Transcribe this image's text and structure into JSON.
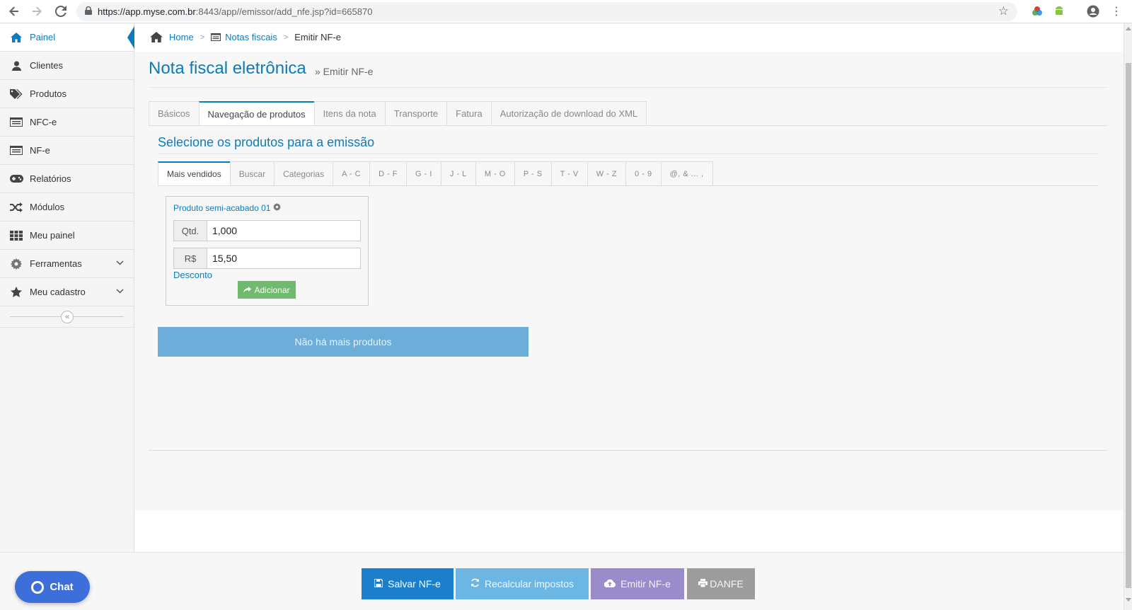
{
  "browser": {
    "url_host": "https://app.myse.com.br",
    "url_rest": ":8443/app//emissor/add_nfe.jsp?id=665870"
  },
  "sidebar": {
    "items": [
      {
        "label": "Painel",
        "icon": "home-icon"
      },
      {
        "label": "Clientes",
        "icon": "user-icon"
      },
      {
        "label": "Produtos",
        "icon": "tags-icon"
      },
      {
        "label": "NFC-e",
        "icon": "list-icon"
      },
      {
        "label": "NF-e",
        "icon": "list-icon"
      },
      {
        "label": "Relatórios",
        "icon": "gamepad-icon"
      },
      {
        "label": "Módulos",
        "icon": "shuffle-icon"
      },
      {
        "label": "Meu painel",
        "icon": "grid-icon"
      },
      {
        "label": "Ferramentas",
        "icon": "gear-icon"
      },
      {
        "label": "Meu cadastro",
        "icon": "star-icon"
      }
    ],
    "collapse_glyph": "«"
  },
  "breadcrumb": {
    "home": "Home",
    "notas": "Notas fiscais",
    "current": "Emitir NF-e"
  },
  "page": {
    "title": "Nota fiscal eletrônica",
    "subtitle": "» Emitir NF-e"
  },
  "main_tabs": [
    "Básicos",
    "Navegação de produtos",
    "Itens da nota",
    "Transporte",
    "Fatura",
    "Autorização de download do XML"
  ],
  "section_title": "Selecione os produtos para a emissão",
  "sub_tabs": [
    "Mais vendidos",
    "Buscar",
    "Categorias",
    "A - C",
    "D - F",
    "G - I",
    "J - L",
    "M - O",
    "P - S",
    "T - V",
    "W - Z",
    "0 - 9",
    "@, & ... ,"
  ],
  "product": {
    "name": "Produto semi-acabado 01",
    "qty_label": "Qtd.",
    "qty_value": "1,000",
    "price_label": "R$",
    "price_value": "15,50",
    "discount_label": "Desconto",
    "add_label": "Adicionar"
  },
  "no_more_products": "Não há mais produtos",
  "footer": {
    "chat": "Chat",
    "save": "Salvar NF-e",
    "recalc": "Recalcular impostos",
    "emit": "Emitir NF-e",
    "danfe": "DANFE"
  },
  "colors": {
    "accent": "#0c7bbd",
    "save": "#1b7fcc",
    "recalc": "#6cb6e4",
    "emit": "#9a8ccb",
    "danfe": "#9c9c9c",
    "add": "#6fba6c",
    "chat": "#3c6fd9"
  }
}
